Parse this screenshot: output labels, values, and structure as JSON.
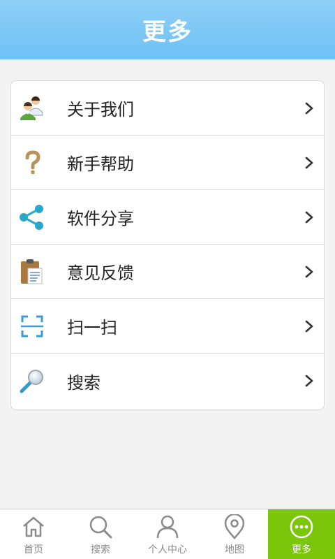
{
  "header": {
    "title": "更多"
  },
  "menu": {
    "items": [
      {
        "label": "关于我们",
        "icon": "users-icon"
      },
      {
        "label": "新手帮助",
        "icon": "question-icon"
      },
      {
        "label": "软件分享",
        "icon": "share-icon"
      },
      {
        "label": "意见反馈",
        "icon": "clipboard-icon"
      },
      {
        "label": "扫一扫",
        "icon": "scan-icon"
      },
      {
        "label": "搜索",
        "icon": "magnifier-icon"
      }
    ]
  },
  "tabbar": {
    "tabs": [
      {
        "label": "首页",
        "icon": "home-icon",
        "active": false
      },
      {
        "label": "搜索",
        "icon": "search-icon",
        "active": false
      },
      {
        "label": "个人中心",
        "icon": "person-icon",
        "active": false
      },
      {
        "label": "地图",
        "icon": "map-pin-icon",
        "active": false
      },
      {
        "label": "更多",
        "icon": "more-icon",
        "active": true
      }
    ]
  },
  "colors": {
    "header_blue": "#6ec0f6",
    "active_tab": "#7bc60a",
    "tab_inactive": "#8a8a8a"
  }
}
